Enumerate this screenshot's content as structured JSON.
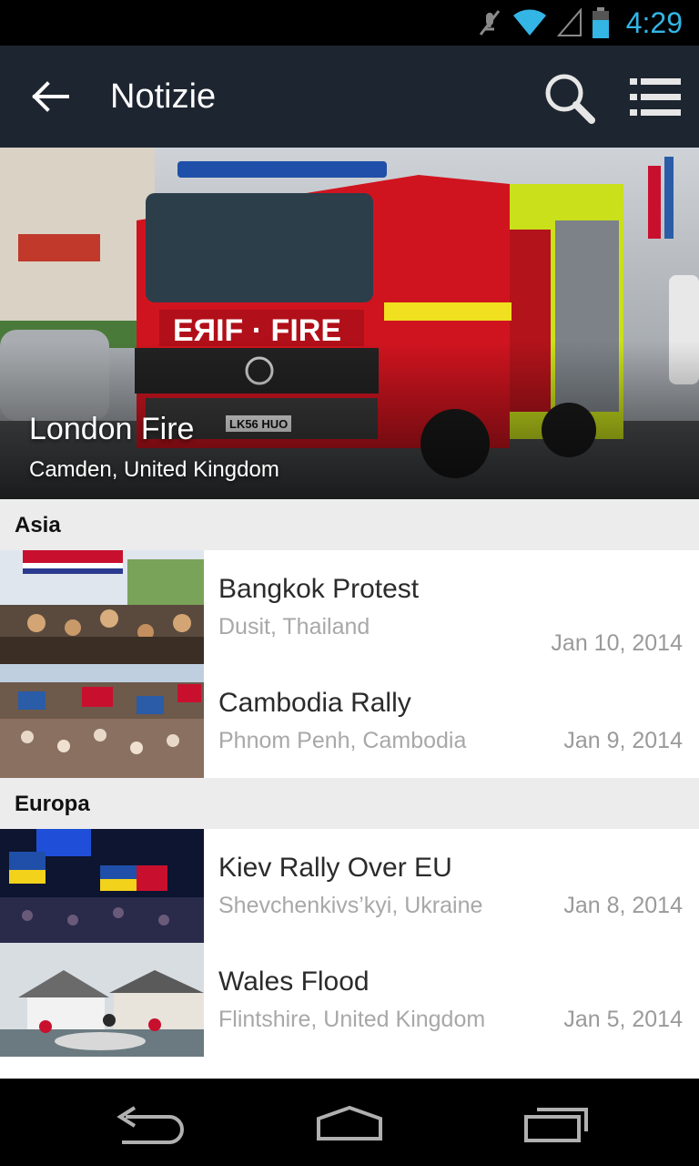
{
  "status_bar": {
    "time": "4:29",
    "icons": [
      "mute-icon",
      "wifi-icon",
      "signal-icon",
      "battery-icon"
    ],
    "accent_color": "#33b5e5"
  },
  "action_bar": {
    "title": "Notizie",
    "icons": [
      "back-arrow-icon",
      "search-icon",
      "list-menu-icon"
    ],
    "background": "#1d2530"
  },
  "hero": {
    "title": "London Fire",
    "subtitle": "Camden, United Kingdom",
    "truck_plate": "LK56 HUO",
    "truck_label": "FIRE"
  },
  "sections": [
    {
      "name": "Asia",
      "items": [
        {
          "title": "Bangkok Protest",
          "location": "Dusit, Thailand",
          "date": "Jan 10, 2014"
        },
        {
          "title": "Cambodia Rally",
          "location": "Phnom Penh, Cambodia",
          "date": "Jan 9, 2014"
        }
      ]
    },
    {
      "name": "Europa",
      "items": [
        {
          "title": "Kiev Rally Over EU",
          "location": "Shevchenkivs’kyi, Ukraine",
          "date": "Jan 8, 2014"
        },
        {
          "title": "Wales Flood",
          "location": "Flintshire, United Kingdom",
          "date": "Jan 5, 2014"
        }
      ]
    }
  ],
  "nav_bar": {
    "icons": [
      "back-nav-icon",
      "home-nav-icon",
      "recents-nav-icon"
    ]
  }
}
